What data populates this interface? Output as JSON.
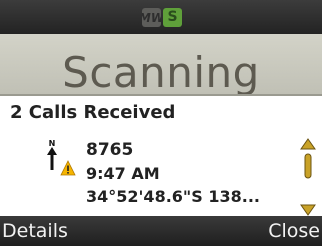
{
  "status_bar": {
    "icons": [
      {
        "name": "mw-icon",
        "label": "MW"
      },
      {
        "name": "s-icon",
        "label": "S"
      }
    ],
    "s_icon_color": "#5fa03a"
  },
  "background_screen": {
    "title": "Scanning"
  },
  "dialog": {
    "title": "2 Calls Received",
    "call": {
      "number": "8765",
      "time": "9:47 AM",
      "coordinates": "34°52'48.6\"S 138..."
    }
  },
  "softkeys": {
    "left_label": "Details",
    "right_label": "Close"
  },
  "colors": {
    "scroll_arrow": "#c9a227",
    "warning": "#f5b400"
  }
}
